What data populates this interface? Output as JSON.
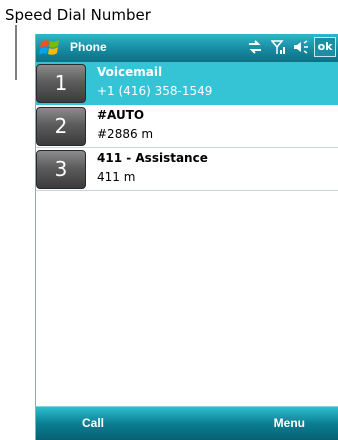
{
  "annotation": {
    "label": "Speed Dial Number"
  },
  "titlebar": {
    "title": "Phone",
    "ok_label": "ok"
  },
  "speed_dials": [
    {
      "key": "1",
      "name": "Voicemail",
      "number": "+1 (416) 358-1549",
      "selected": true
    },
    {
      "key": "2",
      "name": "#AUTO",
      "number": "#2886 m",
      "selected": false
    },
    {
      "key": "3",
      "name": "411 - Assistance",
      "number": "411 m",
      "selected": false
    }
  ],
  "softkeys": {
    "left": "Call",
    "right": "Menu"
  }
}
